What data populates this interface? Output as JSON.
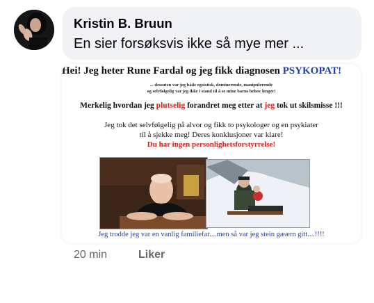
{
  "comment": {
    "author": "Kristin B. Bruun",
    "text": "En sier forsøksvis ikke så mye mer ...",
    "time": "20 min",
    "like_label": "Liker"
  },
  "attachment": {
    "headline_prefix": "Hei! Jeg heter Rune Fardal og jeg fikk diagnosen",
    "headline_emphasis": "PSYKOPAT!",
    "small_line_1": "... dessuten var jeg både egoistisk, dominerende, manipulerende",
    "small_line_2": "og selvfølgelig var jeg ikke i stand til å se mine barns behov lenger!",
    "sentence_part_1": "Merkelig hvordan jeg",
    "sentence_red_1": "plutselig",
    "sentence_part_2": "forandret meg etter at",
    "sentence_red_2": "jeg",
    "sentence_part_3": "tok ut skilsmisse !!!",
    "para_line_1": "Jeg tok det selvfølgelig på alvor og fikk to psykologer og en psykiater",
    "para_line_2": "til å sjekke meg! Deres konklusjoner var klare!",
    "para_line_3": "Du har ingen personlighetsforstyrrelse!",
    "caption": "Jeg trodde jeg var en vanlig familiefar....men så var jeg stein gæærn gitt....!!!!"
  },
  "colors": {
    "bubble_bg": "#f0f2f5",
    "emphasis_blue": "#1f3fae",
    "emphasis_red": "#d32020",
    "meta_gray": "#65676b"
  }
}
